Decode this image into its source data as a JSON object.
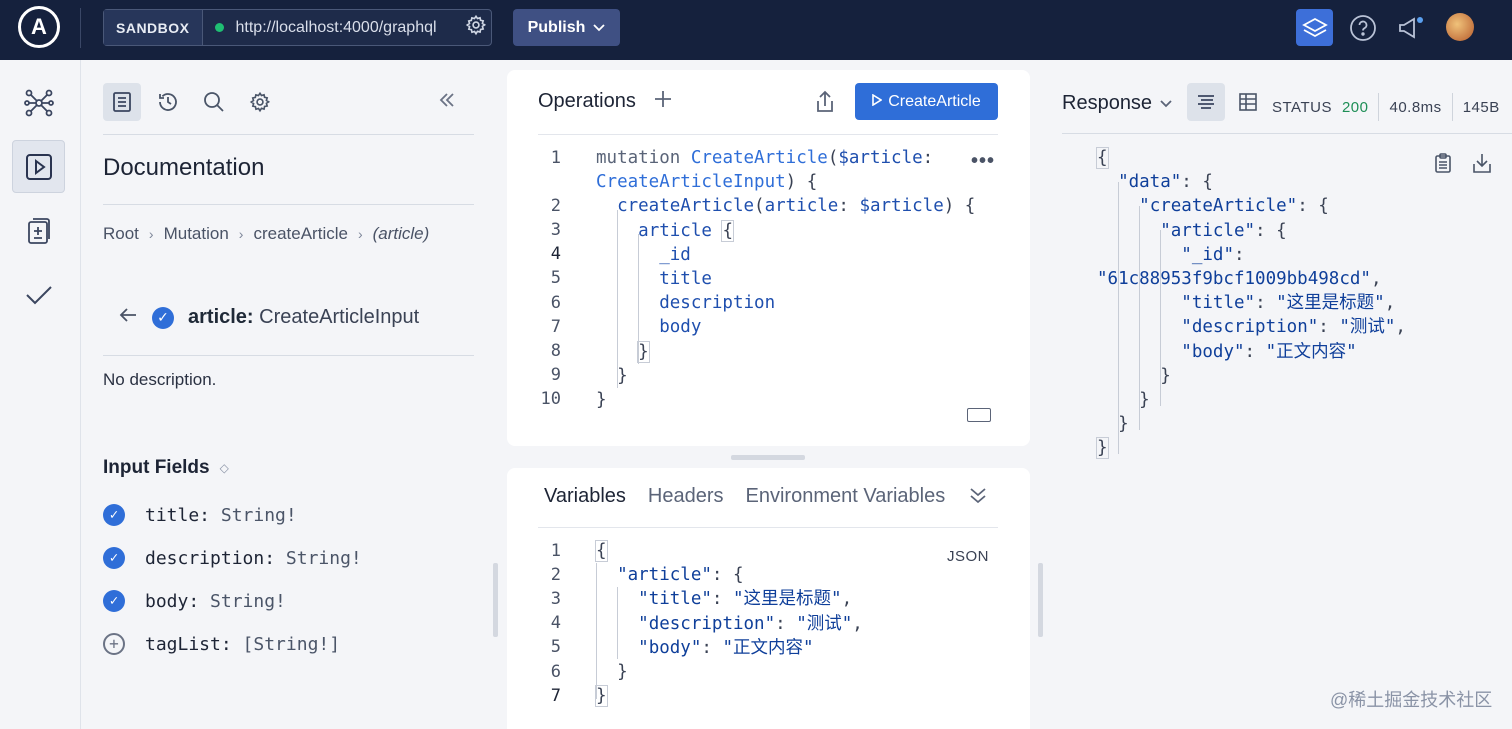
{
  "topbar": {
    "logo_letter": "A",
    "sandbox_label": "SANDBOX",
    "url": "http://localhost:4000/graphql",
    "publish_label": "Publish",
    "icons": [
      "layers-icon",
      "help-icon",
      "megaphone-icon",
      "avatar"
    ]
  },
  "rail": {
    "items": [
      "graph-icon",
      "play-icon",
      "schema-diff-icon",
      "checks-icon"
    ],
    "active": "play-icon"
  },
  "docs": {
    "title": "Documentation",
    "breadcrumb": [
      "Root",
      "Mutation",
      "createArticle",
      "(article)"
    ],
    "argument_name": "article:",
    "argument_type": "CreateArticleInput",
    "description": "No description.",
    "input_fields_heading": "Input Fields",
    "fields": [
      {
        "name": "title:",
        "type": "String!",
        "selected": true
      },
      {
        "name": "description:",
        "type": "String!",
        "selected": true
      },
      {
        "name": "body:",
        "type": "String!",
        "selected": true
      },
      {
        "name": "tagList:",
        "type": "[String!]",
        "selected": false
      }
    ]
  },
  "operations": {
    "title": "Operations",
    "run_label": "CreateArticle",
    "line_numbers": [
      "1",
      "2",
      "3",
      "4",
      "5",
      "6",
      "7",
      "8",
      "9",
      "10"
    ]
  },
  "variables": {
    "tabs": [
      "Variables",
      "Headers",
      "Environment Variables"
    ],
    "active_tab": "Variables",
    "format_label": "JSON",
    "line_numbers": [
      "1",
      "2",
      "3",
      "4",
      "5",
      "6",
      "7"
    ]
  },
  "response": {
    "title": "Response",
    "status_label": "STATUS",
    "status_code": "200",
    "time": "40.8ms",
    "size": "145B"
  },
  "watermark": "@稀土掘金技术社区",
  "colors": {
    "topbar_bg": "#15213d",
    "accent": "#2f6ed8",
    "status_ok": "#1f8f57"
  }
}
